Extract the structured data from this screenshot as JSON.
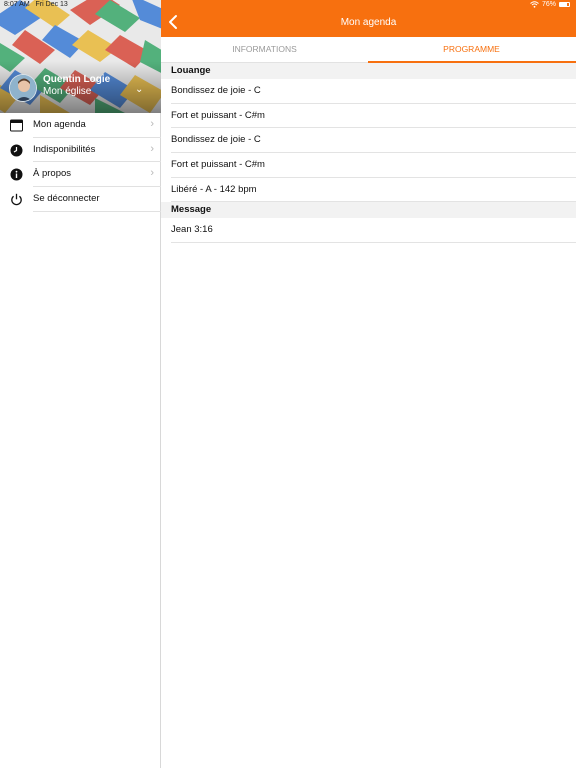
{
  "status_bar": {
    "time": "8:07 AM",
    "date": "Fri Dec 13",
    "battery": "76%",
    "battery_level": 0.76
  },
  "profile": {
    "name": "Quentin Logie",
    "church": "Mon église"
  },
  "sidebar": {
    "items": [
      {
        "label": "Mon agenda",
        "icon": "calendar-icon"
      },
      {
        "label": "Indisponibilités",
        "icon": "clock-icon"
      },
      {
        "label": "À propos",
        "icon": "info-icon"
      },
      {
        "label": "Se déconnecter",
        "icon": "power-icon"
      }
    ]
  },
  "header": {
    "title": "Mon agenda",
    "back_icon": "chevron-left-icon"
  },
  "tabs": [
    {
      "label": "INFORMATIONS",
      "active": false
    },
    {
      "label": "PROGRAMME",
      "active": true
    }
  ],
  "program": {
    "sections": [
      {
        "title": "Louange",
        "items": [
          "Bondissez de joie - C",
          "Fort et puissant - C#m",
          "Bondissez de joie - C",
          "Fort et puissant - C#m",
          "Libéré - A - 142 bpm"
        ]
      },
      {
        "title": "Message",
        "items": [
          "Jean 3:16"
        ]
      }
    ]
  },
  "colors": {
    "accent": "#f7700f",
    "header_text": "#ffffff",
    "section_bg": "#f2f2f2",
    "inactive_tab": "#9a9a9a"
  }
}
